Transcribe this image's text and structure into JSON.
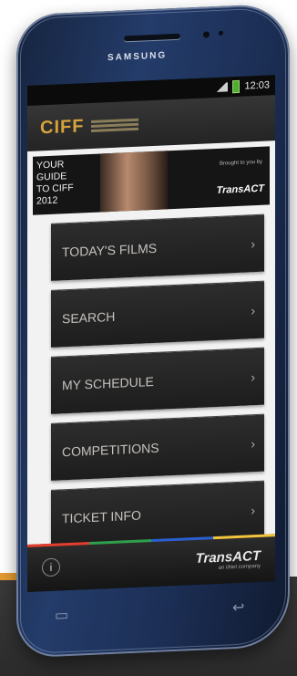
{
  "device": {
    "brand": "SAMSUNG"
  },
  "statusbar": {
    "time": "12:03"
  },
  "app": {
    "logo": "CIFF",
    "banner": {
      "line1": "YOUR GUIDE",
      "line2": "TO CIFF",
      "line3": "2012",
      "brought_by": "Brought to you by",
      "sponsor": "TransACT"
    },
    "menu": [
      {
        "label": "TODAY'S FILMS",
        "chevron": "›"
      },
      {
        "label": "SEARCH",
        "chevron": "›"
      },
      {
        "label": "MY SCHEDULE",
        "chevron": "›"
      },
      {
        "label": "COMPETITIONS",
        "chevron": "›"
      },
      {
        "label": "TICKET INFO",
        "chevron": "›"
      }
    ],
    "bottom": {
      "info_glyph": "i",
      "logo": "TransACT",
      "tagline": "an iiNet company"
    }
  }
}
